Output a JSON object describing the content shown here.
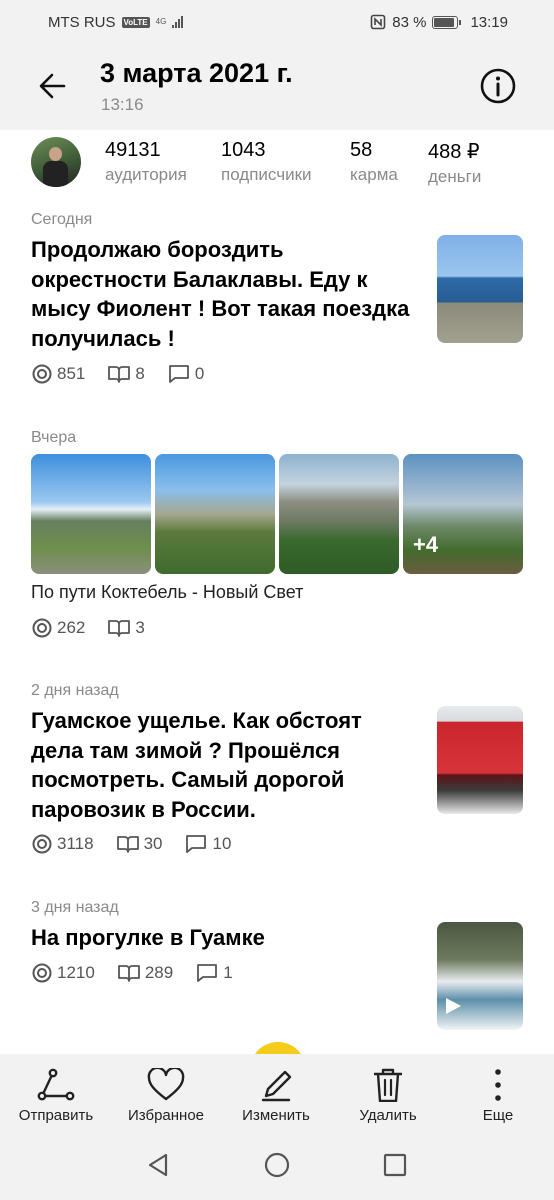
{
  "status_bar": {
    "carrier": "MTS RUS",
    "volte": "VoLTE",
    "network": "4G",
    "battery_percent": "83 %",
    "battery_level": 0.83,
    "time": "13:19"
  },
  "header": {
    "title": "3 марта 2021 г.",
    "subtitle": "13:16",
    "back_icon": "arrow-left-icon",
    "info_icon": "info-circle-icon"
  },
  "stats": [
    {
      "value": "49131",
      "label": "аудитория"
    },
    {
      "value": "1043",
      "label": "подписчики"
    },
    {
      "value": "58",
      "label": "карма"
    },
    {
      "value": "488 ₽",
      "label": "деньги"
    }
  ],
  "posts": [
    {
      "date": "Сегодня",
      "title": "Продолжаю бороздить окрестности Балаклавы. Еду к мысу Фиолент ! Вот такая поездка получилась !",
      "views": "851",
      "reads": "8",
      "comments": "0"
    },
    {
      "date": "2 дня назад",
      "title": "Гуамское ущелье. Как обстоят дела там зимой ? Прошёлся посмотреть. Самый дорогой паровозик в России.",
      "views": "3118",
      "reads": "30",
      "comments": "10"
    },
    {
      "date": "3 дня назад",
      "title": "На прогулке в Гуамке",
      "views": "1210",
      "reads": "289",
      "comments": "1"
    }
  ],
  "gallery": {
    "date": "Вчера",
    "title": "По пути Коктебель - Новый Свет",
    "more": "+4",
    "views": "262",
    "reads": "3"
  },
  "toolbar": [
    {
      "label": "Отправить",
      "icon": "share-icon"
    },
    {
      "label": "Избранное",
      "icon": "heart-icon"
    },
    {
      "label": "Изменить",
      "icon": "pencil-icon"
    },
    {
      "label": "Удалить",
      "icon": "trash-icon"
    },
    {
      "label": "Еще",
      "icon": "more-vertical-icon"
    }
  ],
  "nav": {
    "back": "nav-back-icon",
    "home": "nav-home-icon",
    "recents": "nav-recents-icon"
  },
  "colors": {
    "accent": "#f5cc1a",
    "bar_bg": "#f2f2f2",
    "muted_text": "#8a8a8a"
  }
}
